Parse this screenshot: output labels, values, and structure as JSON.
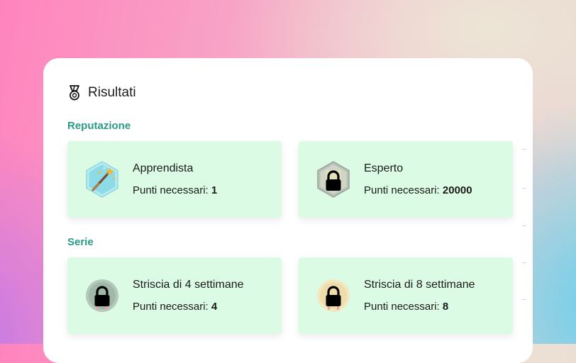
{
  "panel": {
    "title": "Risultati",
    "title_icon": "medal-icon"
  },
  "sections": [
    {
      "label": "Reputazione",
      "badges": [
        {
          "name": "Apprendista",
          "points_label": "Punti necessari:",
          "points": "1",
          "locked": false,
          "icon": "magic-wand-hexagon-icon"
        },
        {
          "name": "Esperto",
          "points_label": "Punti necessari:",
          "points": "20000",
          "locked": true,
          "icon": "lock-hexagon-icon"
        }
      ]
    },
    {
      "label": "Serie",
      "badges": [
        {
          "name": "Striscia di 4 settimane",
          "points_label": "Punti necessari:",
          "points": "4",
          "locked": true,
          "icon": "lock-circle-icon"
        },
        {
          "name": "Striscia di 8 settimane",
          "points_label": "Punti necessari:",
          "points": "8",
          "locked": true,
          "icon": "lock-circle-icon"
        }
      ]
    }
  ],
  "colors": {
    "section_label": "#2b9a86",
    "badge_bg": "#dcfbe4",
    "panel_bg": "#ffffff"
  }
}
